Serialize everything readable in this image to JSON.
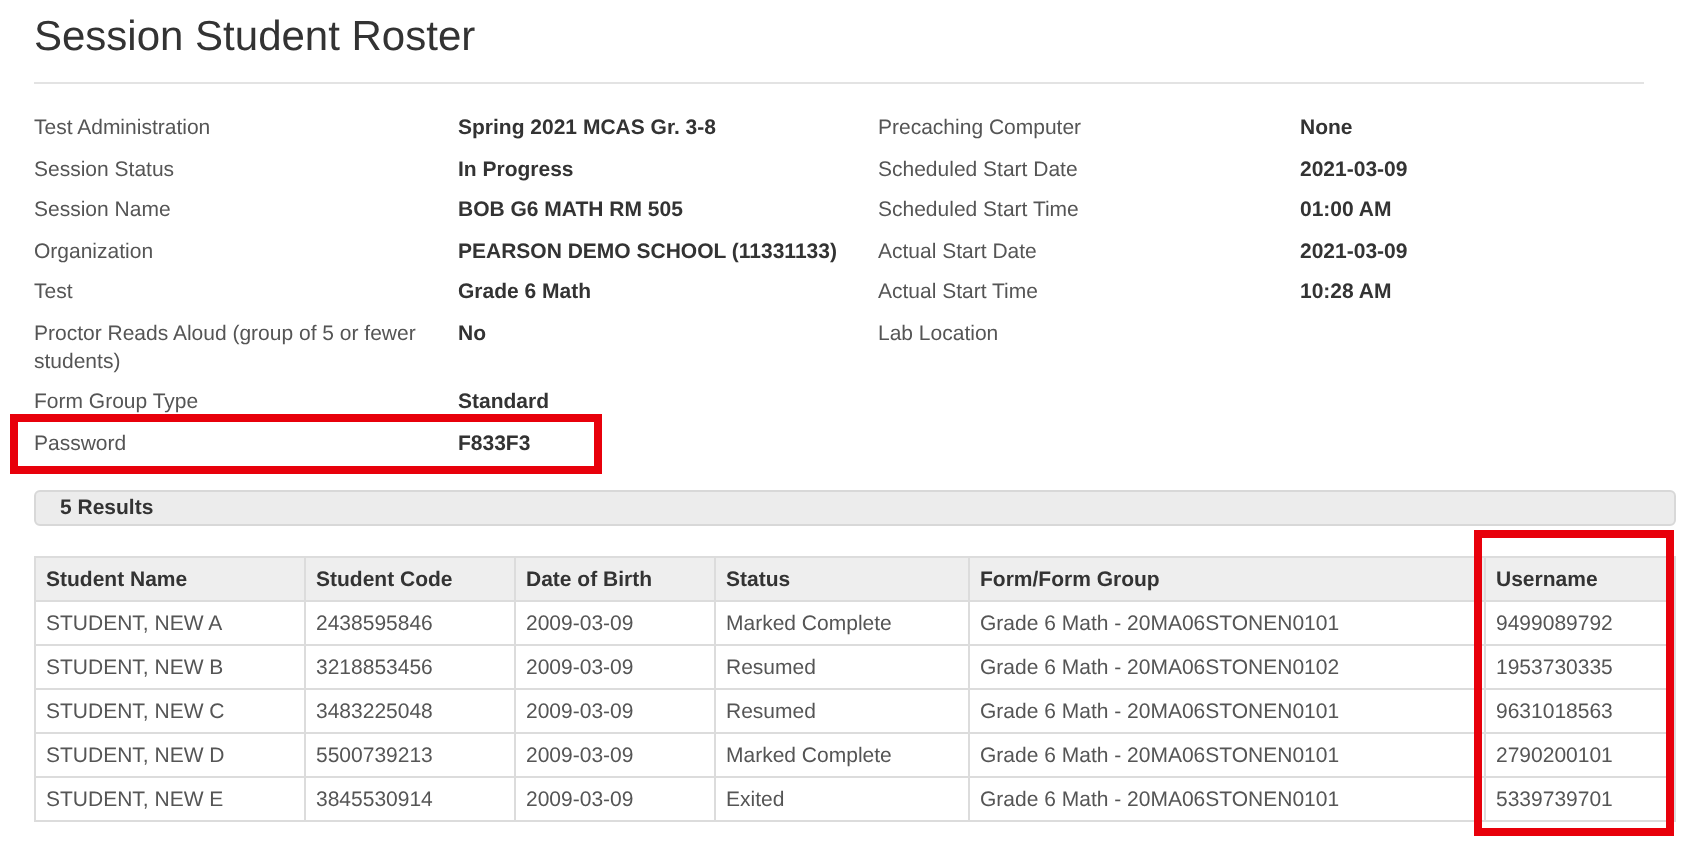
{
  "title": "Session Student Roster",
  "details": {
    "left": [
      {
        "label": "Test Administration",
        "value": "Spring 2021 MCAS Gr. 3-8",
        "highlighted": false
      },
      {
        "label": "Session Status",
        "value": "In Progress",
        "highlighted": false
      },
      {
        "label": "Session Name",
        "value": "BOB G6 MATH RM 505",
        "highlighted": false
      },
      {
        "label": "Organization",
        "value": "PEARSON DEMO SCHOOL (11331133)",
        "highlighted": false
      },
      {
        "label": "Test",
        "value": "Grade 6 Math",
        "highlighted": false
      },
      {
        "label": "Proctor Reads Aloud (group of 5 or fewer students)",
        "value": "No",
        "highlighted": false
      },
      {
        "label": "Form Group Type",
        "value": "Standard",
        "highlighted": false
      },
      {
        "label": "Password",
        "value": "F833F3",
        "highlighted": true
      }
    ],
    "right": [
      {
        "label": "Precaching Computer",
        "value": "None"
      },
      {
        "label": "Scheduled Start Date",
        "value": "2021-03-09"
      },
      {
        "label": "Scheduled Start Time",
        "value": "01:00 AM"
      },
      {
        "label": "Actual Start Date",
        "value": "2021-03-09"
      },
      {
        "label": "Actual Start Time",
        "value": "10:28 AM"
      },
      {
        "label": "Lab Location"
      }
    ]
  },
  "results": "5 Results",
  "table": {
    "columns": [
      {
        "label": "Student Name",
        "highlighted": false
      },
      {
        "label": "Student Code",
        "highlighted": false
      },
      {
        "label": "Date of Birth",
        "highlighted": false
      },
      {
        "label": "Status",
        "highlighted": false
      },
      {
        "label": "Form/Form Group",
        "highlighted": false
      },
      {
        "label": "Username",
        "highlighted": true
      }
    ],
    "rows": [
      [
        "STUDENT, NEW A",
        "2438595846",
        "2009-03-09",
        "Marked Complete",
        "Grade 6 Math - 20MA06STONEN0101",
        "9499089792"
      ],
      [
        "STUDENT, NEW B",
        "3218853456",
        "2009-03-09",
        "Resumed",
        "Grade 6 Math - 20MA06STONEN0102",
        "1953730335"
      ],
      [
        "STUDENT, NEW C",
        "3483225048",
        "2009-03-09",
        "Resumed",
        "Grade 6 Math - 20MA06STONEN0101",
        "9631018563"
      ],
      [
        "STUDENT, NEW D",
        "5500739213",
        "2009-03-09",
        "Marked Complete",
        "Grade 6 Math - 20MA06STONEN0101",
        "2790200101"
      ],
      [
        "STUDENT, NEW E",
        "3845530914",
        "2009-03-09",
        "Exited",
        "Grade 6 Math - 20MA06STONEN0101",
        "5339739701"
      ]
    ]
  }
}
